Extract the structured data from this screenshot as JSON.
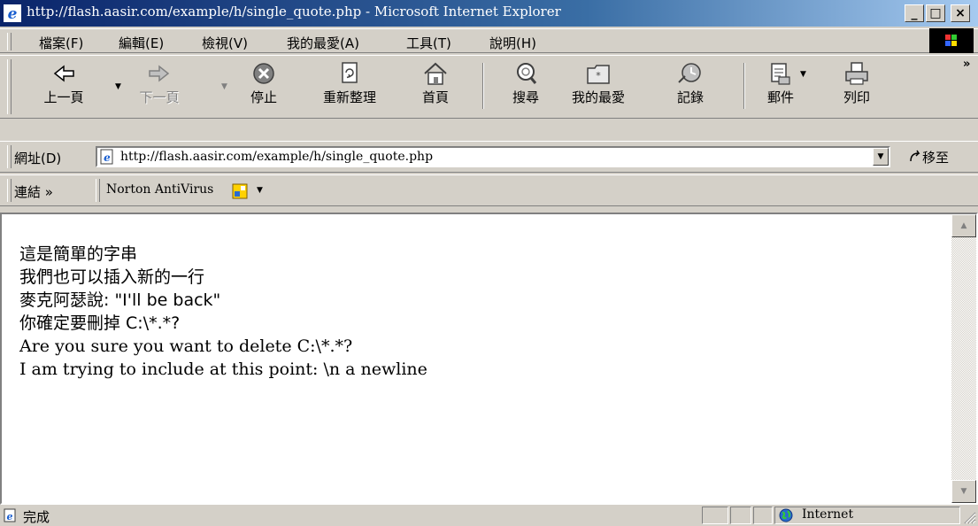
{
  "window": {
    "title": "http://flash.aasir.com/example/h/single_quote.php - Microsoft Internet Explorer",
    "minimize": "_",
    "maximize": "□",
    "close": "×"
  },
  "menu": {
    "items": [
      "檔案(F)",
      "編輯(E)",
      "檢視(V)",
      "我的最愛(A)",
      "工具(T)",
      "說明(H)"
    ]
  },
  "toolbar": {
    "back": "上一頁",
    "forward": "下一頁",
    "stop": "停止",
    "refresh": "重新整理",
    "home": "首頁",
    "search": "搜尋",
    "favorites": "我的最愛",
    "history": "記錄",
    "mail": "郵件",
    "print": "列印",
    "more": "»"
  },
  "address": {
    "label": "網址(D)",
    "url": "http://flash.aasir.com/example/h/single_quote.php",
    "go": "移至"
  },
  "links": {
    "label": "連結 »",
    "item": "Norton AntiVirus"
  },
  "content": {
    "lines": [
      "這是簡單的字串",
      "我們也可以插入新的一行",
      "麥克阿瑟說: \"I'll be back\"",
      "你確定要刪掉 C:\\*.*?",
      "Are you sure you want to delete C:\\*.*?",
      "I am trying to include at this point: \\n a newline"
    ]
  },
  "status": {
    "text": "完成",
    "zone": "Internet"
  },
  "colors": {
    "titlebar_start": "#0a246a",
    "titlebar_end": "#a6caf0",
    "chrome": "#d4d0c8"
  }
}
